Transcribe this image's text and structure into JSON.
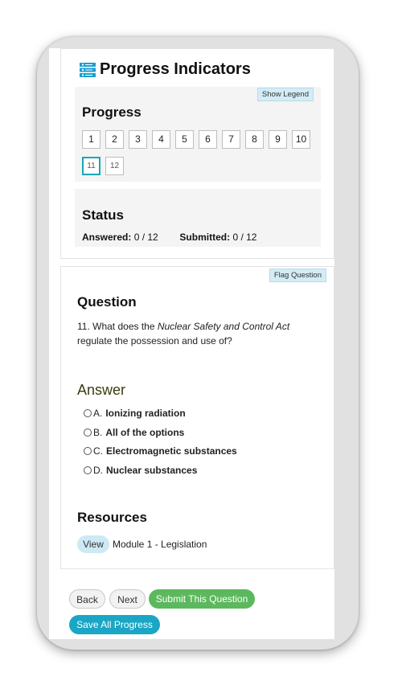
{
  "header": {
    "title": "Progress Indicators",
    "icon": "list-icon"
  },
  "progress": {
    "legend_label": "Show Legend",
    "heading": "Progress",
    "pages": [
      "1",
      "2",
      "3",
      "4",
      "5",
      "6",
      "7",
      "8",
      "9",
      "10",
      "11",
      "12"
    ],
    "current_page": "11"
  },
  "status": {
    "heading": "Status",
    "answered_label": "Answered:",
    "answered_value": "0 / 12",
    "submitted_label": "Submitted:",
    "submitted_value": "0 / 12"
  },
  "question": {
    "flag_label": "Flag Question",
    "heading": "Question",
    "text_prefix": "11. What does the ",
    "text_emphasis": "Nuclear Safety and Control Act",
    "text_suffix": " regulate the possession and use of?"
  },
  "answer": {
    "heading": "Answer",
    "options": [
      {
        "letter": "A.",
        "text": "Ionizing radiation"
      },
      {
        "letter": "B.",
        "text": "All of the options"
      },
      {
        "letter": "C.",
        "text": "Electromagnetic substances"
      },
      {
        "letter": "D.",
        "text": "Nuclear substances"
      }
    ]
  },
  "resources": {
    "heading": "Resources",
    "view_label": "View",
    "item_label": "Module 1 - Legislation"
  },
  "footer": {
    "back_label": "Back",
    "next_label": "Next",
    "submit_label": "Submit This Question",
    "save_label": "Save All Progress"
  },
  "colors": {
    "accent": "#1aa6c4",
    "submit": "#5cb85c",
    "current_border": "#1aa6b7"
  }
}
